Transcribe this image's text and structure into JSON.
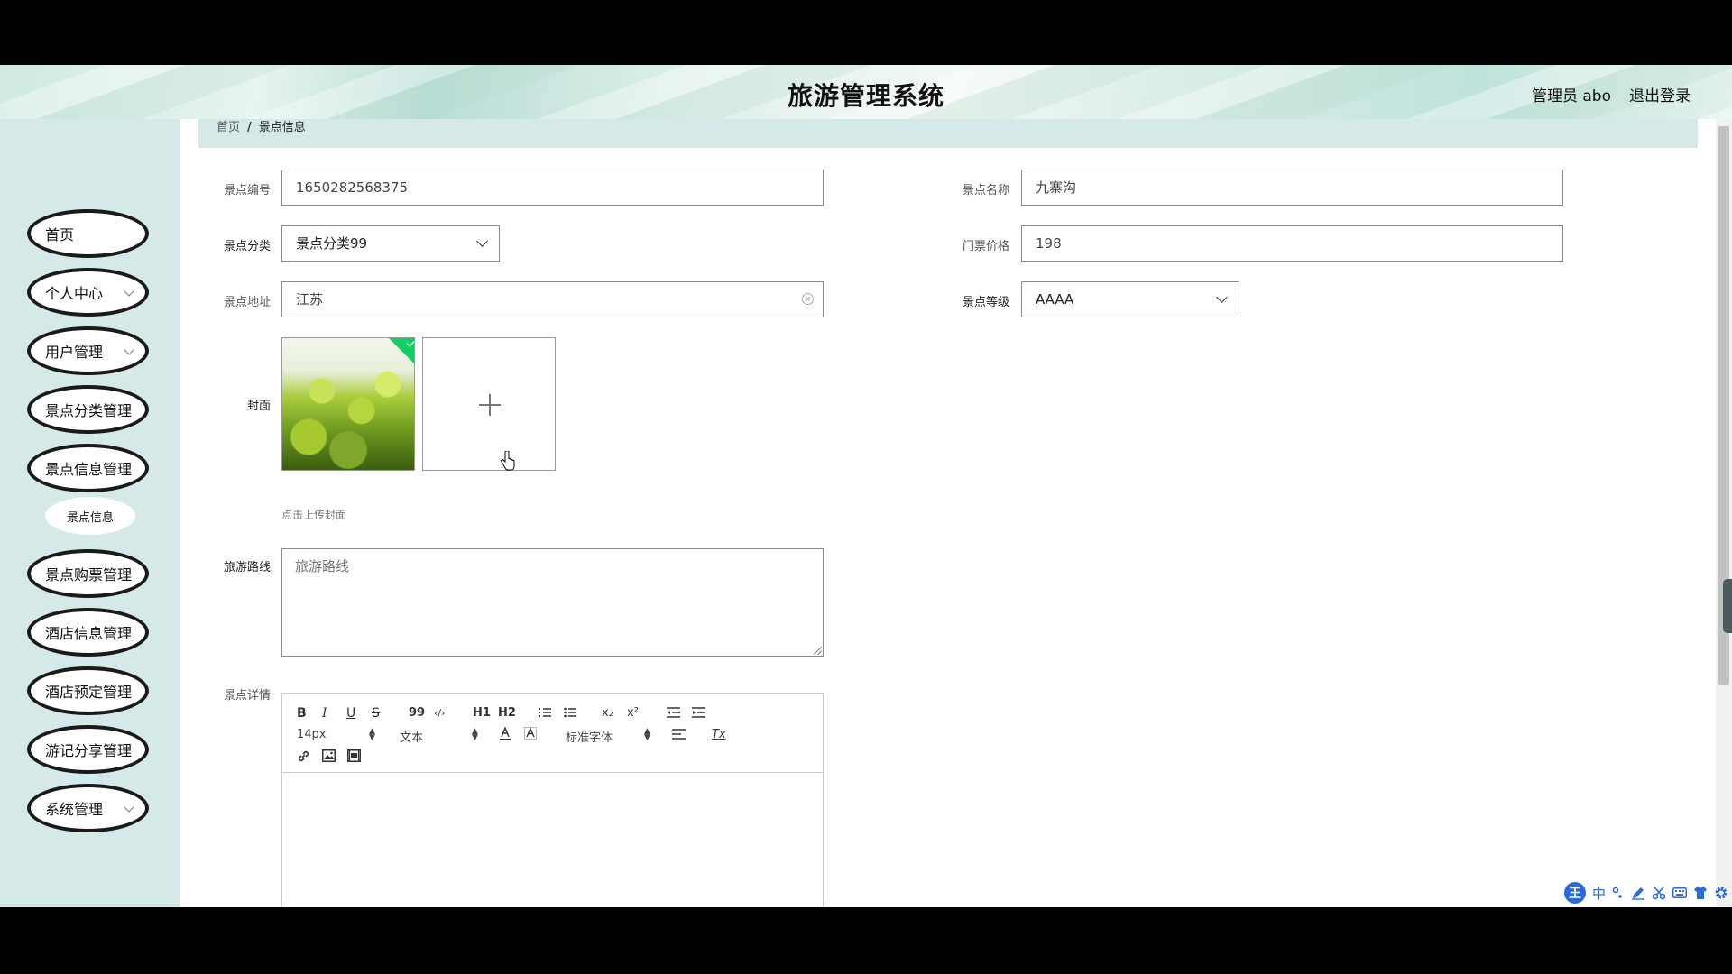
{
  "header": {
    "title": "旅游管理系统",
    "admin_label": "管理员 abo",
    "logout_label": "退出登录"
  },
  "sidebar": {
    "items": [
      {
        "label": "首页",
        "has_children": false
      },
      {
        "label": "个人中心",
        "has_children": true
      },
      {
        "label": "用户管理",
        "has_children": true
      },
      {
        "label": "景点分类管理",
        "has_children": false
      },
      {
        "label": "景点信息管理",
        "has_children": false
      },
      {
        "label": "景点购票管理",
        "has_children": false
      },
      {
        "label": "酒店信息管理",
        "has_children": false
      },
      {
        "label": "酒店预定管理",
        "has_children": false
      },
      {
        "label": "游记分享管理",
        "has_children": false
      },
      {
        "label": "系统管理",
        "has_children": true
      }
    ],
    "sub_item": "景点信息"
  },
  "breadcrumb": {
    "home": "首页",
    "separator": "/",
    "current": "景点信息"
  },
  "form": {
    "id": {
      "label": "景点编号",
      "value": "1650282568375"
    },
    "name": {
      "label": "景点名称",
      "value": "九寨沟"
    },
    "category": {
      "label": "景点分类",
      "value": "景点分类99"
    },
    "price": {
      "label": "门票价格",
      "value": "198"
    },
    "address": {
      "label": "景点地址",
      "value": "江苏"
    },
    "level": {
      "label": "景点等级",
      "value": "AAAA"
    },
    "cover": {
      "label": "封面",
      "hint": "点击上传封面"
    },
    "route": {
      "label": "旅游路线",
      "placeholder": "旅游路线"
    },
    "detail": {
      "label": "景点详情"
    }
  },
  "editor": {
    "font_size": "14px",
    "header_select": "文本",
    "font_family": "标准字体",
    "buttons": {
      "bold": "B",
      "italic": "I",
      "underline": "U",
      "strike": "S",
      "blockquote": "99",
      "code": "‹/›",
      "h1": "H1",
      "h2": "H2",
      "subscript": "x₂",
      "superscript": "x²",
      "clean": "Tx"
    }
  },
  "ime": {
    "logo": "王",
    "mode": "中"
  },
  "colors": {
    "sidebar_bg": "#d5e9e8",
    "success_badge": "#13ce66",
    "ime_blue": "#2a6bd9"
  }
}
